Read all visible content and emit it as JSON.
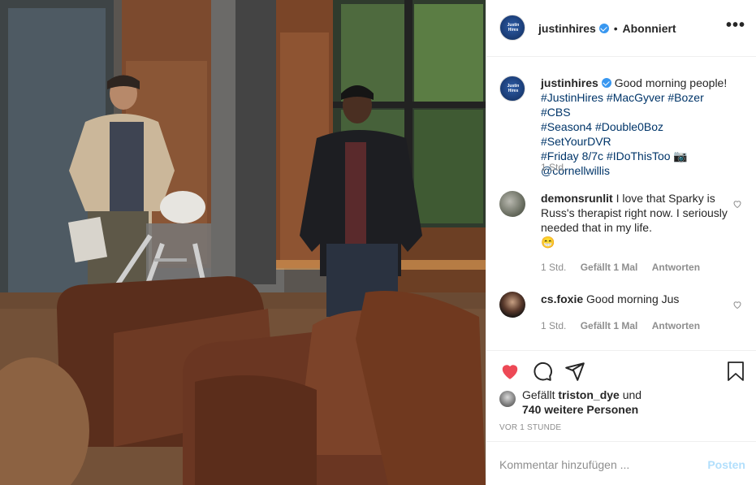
{
  "post": {
    "username": "justinhires",
    "follow_status": "Abonniert",
    "more_label": "•••",
    "avatar_text": "Justin Hires",
    "caption": {
      "username": "justinhires",
      "line1": "Good morning people!",
      "hashtags_line1": "#JustinHires #MacGyver #Bozer #CBS",
      "hashtags_line2": "#Season4 #Double0Boz #SetYourDVR",
      "hashtags_line3": "#Friday 8/7c #IDoThisToo 📷",
      "mention": "@cornellwillis",
      "time": "1 Std."
    },
    "comments": [
      {
        "username": "demonsrunlit",
        "text": "I love that Sparky is Russ's therapist right now. I seriously needed that in my life.",
        "emoji": "😁",
        "time": "1 Std.",
        "likes": "Gefällt 1 Mal",
        "reply": "Antworten"
      },
      {
        "username": "cs.foxie",
        "text": "Good morning Jus",
        "time": "1 Std.",
        "likes": "Gefällt 1 Mal",
        "reply": "Antworten"
      }
    ],
    "likes": {
      "prefix": "Gefällt",
      "user": "triston_dye",
      "conj": "und",
      "others": "740 weitere Personen"
    },
    "timestamp": "VOR 1 STUNDE",
    "comment_placeholder": "Kommentar hinzufügen ...",
    "post_button": "Posten",
    "colors": {
      "like_red": "#ed4956",
      "verified_blue": "#3897f0",
      "post_disabled": "#b2dffc"
    },
    "liked": true
  }
}
